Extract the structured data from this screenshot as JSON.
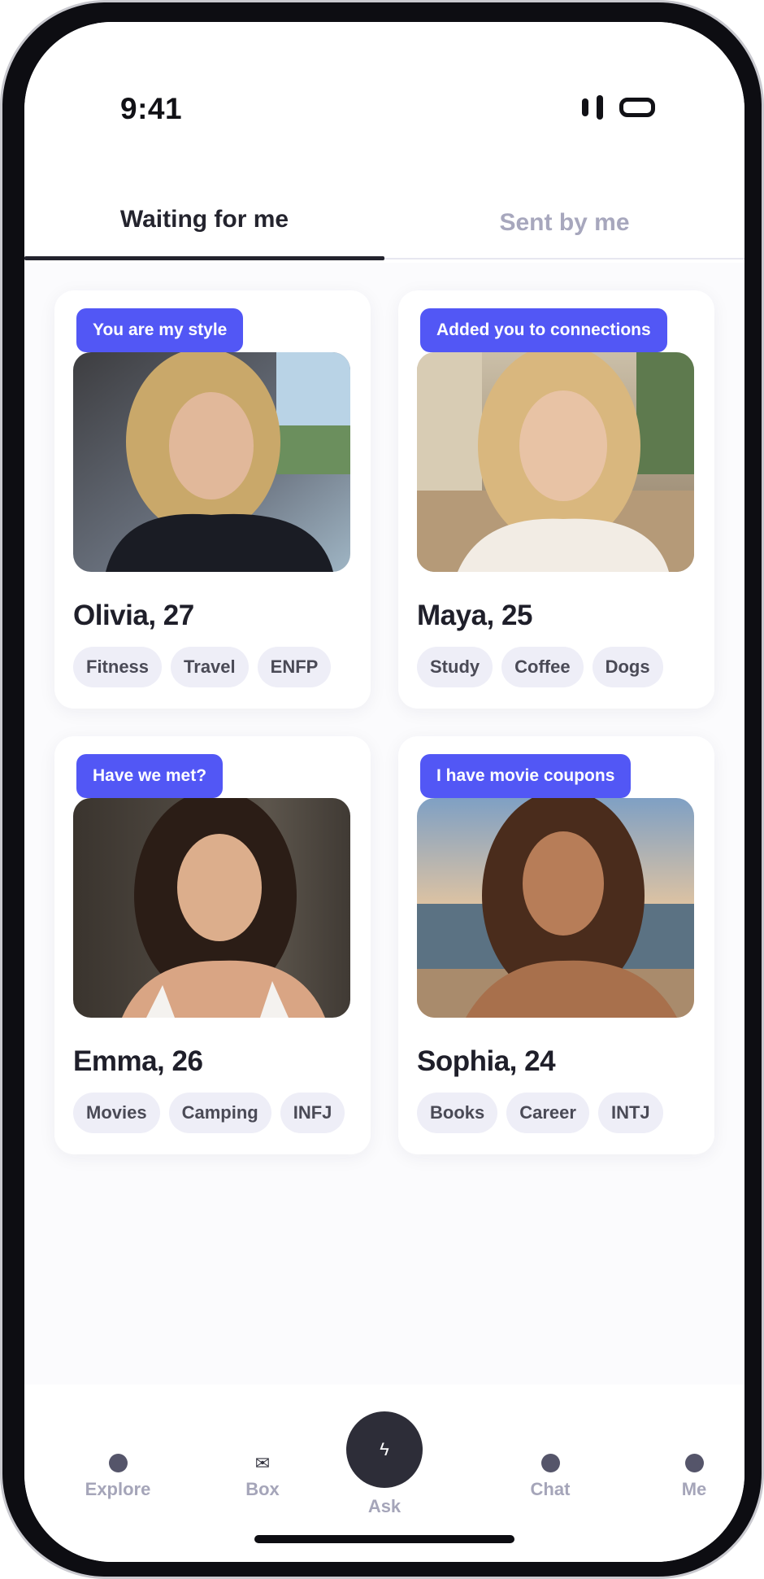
{
  "status_bar": {
    "time": "9:41"
  },
  "tabs": {
    "waiting": "Waiting for me",
    "sent": "Sent by me"
  },
  "cards": [
    {
      "badge": "You are my style",
      "name": "Olivia, 27",
      "tags": [
        "Fitness",
        "Travel",
        "ENFP"
      ]
    },
    {
      "badge": "Added you to connections",
      "name": "Maya, 25",
      "tags": [
        "Study",
        "Coffee",
        "Dogs"
      ]
    },
    {
      "badge": "Have we met?",
      "name": "Emma, 26",
      "tags": [
        "Movies",
        "Camping",
        "INFJ"
      ]
    },
    {
      "badge": "I have movie coupons",
      "name": "Sophia, 24",
      "tags": [
        "Books",
        "Career",
        "INTJ"
      ]
    }
  ],
  "nav": {
    "explore": "Explore",
    "box": "Box",
    "ask": "Ask",
    "chat": "Chat",
    "me": "Me",
    "box_icon": "✉",
    "ask_icon": "ϟ"
  },
  "colors": {
    "accent": "#5257f5",
    "tab_active": "#24242e",
    "tab_inactive": "#a7a7bd",
    "tag_bg": "#eeeef7",
    "nav_label": "#a5a5b9"
  }
}
